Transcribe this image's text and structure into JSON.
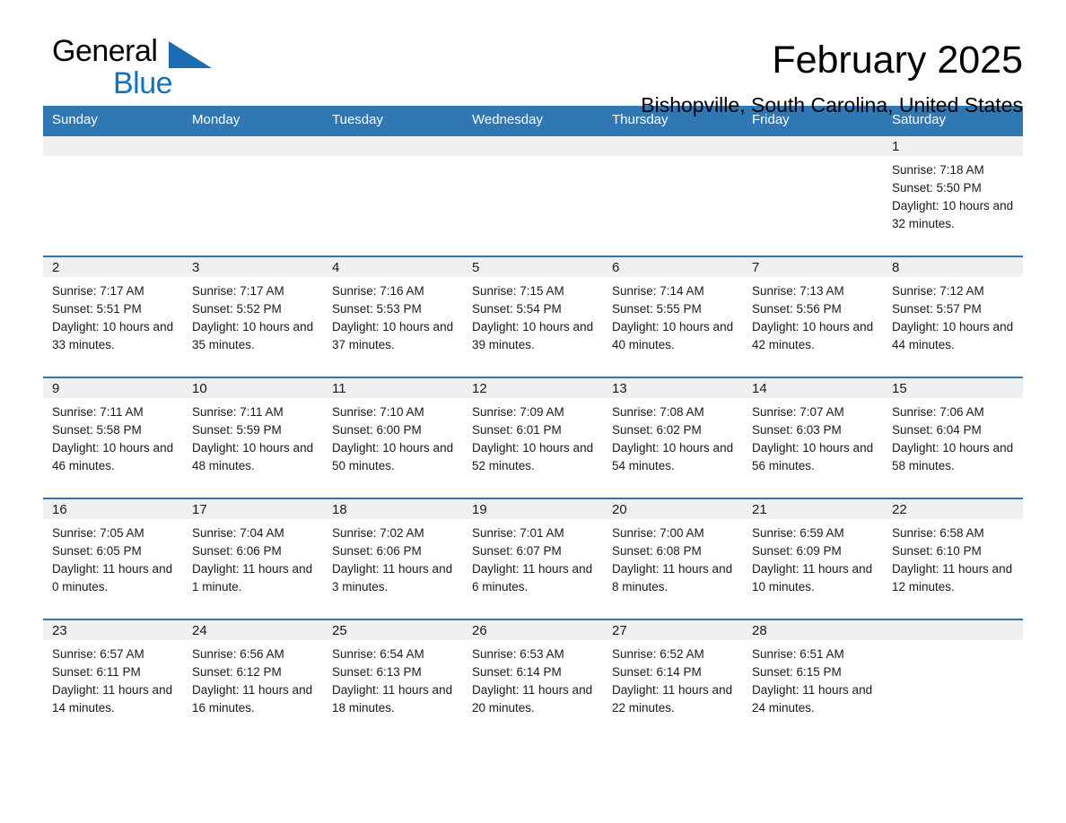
{
  "logo": {
    "word_one": "General",
    "word_two": "Blue",
    "triangle": "triangle-icon"
  },
  "header": {
    "title": "February 2025",
    "subtitle": "Bishopville, South Carolina, United States"
  },
  "colors": {
    "header_blue": "#2f77b5",
    "logo_blue": "#1473bb",
    "daynum_band": "#f0f0f0",
    "text": "#1a1a1a"
  },
  "weekdays": [
    "Sunday",
    "Monday",
    "Tuesday",
    "Wednesday",
    "Thursday",
    "Friday",
    "Saturday"
  ],
  "labels": {
    "sunrise_prefix": "Sunrise:",
    "sunset_prefix": "Sunset:",
    "daylight_prefix": "Daylight:"
  },
  "weeks": [
    [
      {
        "day": "",
        "sunrise": "",
        "sunset": "",
        "daylight": ""
      },
      {
        "day": "",
        "sunrise": "",
        "sunset": "",
        "daylight": ""
      },
      {
        "day": "",
        "sunrise": "",
        "sunset": "",
        "daylight": ""
      },
      {
        "day": "",
        "sunrise": "",
        "sunset": "",
        "daylight": ""
      },
      {
        "day": "",
        "sunrise": "",
        "sunset": "",
        "daylight": ""
      },
      {
        "day": "",
        "sunrise": "",
        "sunset": "",
        "daylight": ""
      },
      {
        "day": "1",
        "sunrise": "Sunrise: 7:18 AM",
        "sunset": "Sunset: 5:50 PM",
        "daylight": "Daylight: 10 hours and 32 minutes."
      }
    ],
    [
      {
        "day": "2",
        "sunrise": "Sunrise: 7:17 AM",
        "sunset": "Sunset: 5:51 PM",
        "daylight": "Daylight: 10 hours and 33 minutes."
      },
      {
        "day": "3",
        "sunrise": "Sunrise: 7:17 AM",
        "sunset": "Sunset: 5:52 PM",
        "daylight": "Daylight: 10 hours and 35 minutes."
      },
      {
        "day": "4",
        "sunrise": "Sunrise: 7:16 AM",
        "sunset": "Sunset: 5:53 PM",
        "daylight": "Daylight: 10 hours and 37 minutes."
      },
      {
        "day": "5",
        "sunrise": "Sunrise: 7:15 AM",
        "sunset": "Sunset: 5:54 PM",
        "daylight": "Daylight: 10 hours and 39 minutes."
      },
      {
        "day": "6",
        "sunrise": "Sunrise: 7:14 AM",
        "sunset": "Sunset: 5:55 PM",
        "daylight": "Daylight: 10 hours and 40 minutes."
      },
      {
        "day": "7",
        "sunrise": "Sunrise: 7:13 AM",
        "sunset": "Sunset: 5:56 PM",
        "daylight": "Daylight: 10 hours and 42 minutes."
      },
      {
        "day": "8",
        "sunrise": "Sunrise: 7:12 AM",
        "sunset": "Sunset: 5:57 PM",
        "daylight": "Daylight: 10 hours and 44 minutes."
      }
    ],
    [
      {
        "day": "9",
        "sunrise": "Sunrise: 7:11 AM",
        "sunset": "Sunset: 5:58 PM",
        "daylight": "Daylight: 10 hours and 46 minutes."
      },
      {
        "day": "10",
        "sunrise": "Sunrise: 7:11 AM",
        "sunset": "Sunset: 5:59 PM",
        "daylight": "Daylight: 10 hours and 48 minutes."
      },
      {
        "day": "11",
        "sunrise": "Sunrise: 7:10 AM",
        "sunset": "Sunset: 6:00 PM",
        "daylight": "Daylight: 10 hours and 50 minutes."
      },
      {
        "day": "12",
        "sunrise": "Sunrise: 7:09 AM",
        "sunset": "Sunset: 6:01 PM",
        "daylight": "Daylight: 10 hours and 52 minutes."
      },
      {
        "day": "13",
        "sunrise": "Sunrise: 7:08 AM",
        "sunset": "Sunset: 6:02 PM",
        "daylight": "Daylight: 10 hours and 54 minutes."
      },
      {
        "day": "14",
        "sunrise": "Sunrise: 7:07 AM",
        "sunset": "Sunset: 6:03 PM",
        "daylight": "Daylight: 10 hours and 56 minutes."
      },
      {
        "day": "15",
        "sunrise": "Sunrise: 7:06 AM",
        "sunset": "Sunset: 6:04 PM",
        "daylight": "Daylight: 10 hours and 58 minutes."
      }
    ],
    [
      {
        "day": "16",
        "sunrise": "Sunrise: 7:05 AM",
        "sunset": "Sunset: 6:05 PM",
        "daylight": "Daylight: 11 hours and 0 minutes."
      },
      {
        "day": "17",
        "sunrise": "Sunrise: 7:04 AM",
        "sunset": "Sunset: 6:06 PM",
        "daylight": "Daylight: 11 hours and 1 minute."
      },
      {
        "day": "18",
        "sunrise": "Sunrise: 7:02 AM",
        "sunset": "Sunset: 6:06 PM",
        "daylight": "Daylight: 11 hours and 3 minutes."
      },
      {
        "day": "19",
        "sunrise": "Sunrise: 7:01 AM",
        "sunset": "Sunset: 6:07 PM",
        "daylight": "Daylight: 11 hours and 6 minutes."
      },
      {
        "day": "20",
        "sunrise": "Sunrise: 7:00 AM",
        "sunset": "Sunset: 6:08 PM",
        "daylight": "Daylight: 11 hours and 8 minutes."
      },
      {
        "day": "21",
        "sunrise": "Sunrise: 6:59 AM",
        "sunset": "Sunset: 6:09 PM",
        "daylight": "Daylight: 11 hours and 10 minutes."
      },
      {
        "day": "22",
        "sunrise": "Sunrise: 6:58 AM",
        "sunset": "Sunset: 6:10 PM",
        "daylight": "Daylight: 11 hours and 12 minutes."
      }
    ],
    [
      {
        "day": "23",
        "sunrise": "Sunrise: 6:57 AM",
        "sunset": "Sunset: 6:11 PM",
        "daylight": "Daylight: 11 hours and 14 minutes."
      },
      {
        "day": "24",
        "sunrise": "Sunrise: 6:56 AM",
        "sunset": "Sunset: 6:12 PM",
        "daylight": "Daylight: 11 hours and 16 minutes."
      },
      {
        "day": "25",
        "sunrise": "Sunrise: 6:54 AM",
        "sunset": "Sunset: 6:13 PM",
        "daylight": "Daylight: 11 hours and 18 minutes."
      },
      {
        "day": "26",
        "sunrise": "Sunrise: 6:53 AM",
        "sunset": "Sunset: 6:14 PM",
        "daylight": "Daylight: 11 hours and 20 minutes."
      },
      {
        "day": "27",
        "sunrise": "Sunrise: 6:52 AM",
        "sunset": "Sunset: 6:14 PM",
        "daylight": "Daylight: 11 hours and 22 minutes."
      },
      {
        "day": "28",
        "sunrise": "Sunrise: 6:51 AM",
        "sunset": "Sunset: 6:15 PM",
        "daylight": "Daylight: 11 hours and 24 minutes."
      },
      {
        "day": "",
        "sunrise": "",
        "sunset": "",
        "daylight": ""
      }
    ]
  ]
}
